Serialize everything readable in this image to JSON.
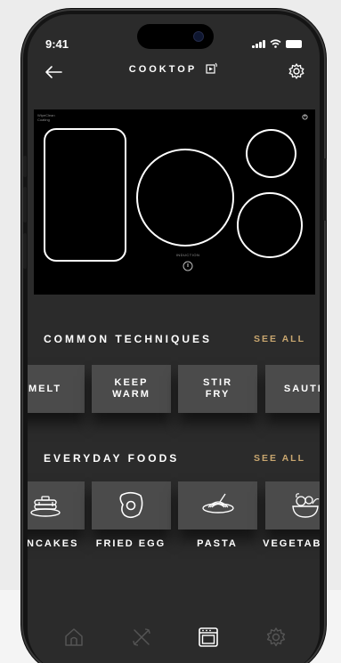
{
  "status_bar": {
    "time": "9:41"
  },
  "header": {
    "title": "COOKTOP"
  },
  "cooktop": {
    "brand": "WipeClean Coating",
    "induction_label": "INDUCTION"
  },
  "common_techniques": {
    "title": "COMMON TECHNIQUES",
    "see_all": "SEE ALL",
    "items": [
      {
        "label": "MELT"
      },
      {
        "label": "KEEP WARM"
      },
      {
        "label": "STIR FRY"
      },
      {
        "label": "SAUTE"
      }
    ]
  },
  "everyday_foods": {
    "title": "EVERYDAY FOODS",
    "see_all": "SEE ALL",
    "items": [
      {
        "label": "PANCAKES",
        "icon": "pancakes-icon"
      },
      {
        "label": "FRIED EGG",
        "icon": "fried-egg-icon"
      },
      {
        "label": "PASTA",
        "icon": "pasta-icon"
      },
      {
        "label": "VEGETABLES",
        "icon": "vegetables-icon"
      }
    ]
  },
  "tab_bar": {
    "items": [
      {
        "icon": "home-icon",
        "active": false
      },
      {
        "icon": "utensils-icon",
        "active": false
      },
      {
        "icon": "oven-icon",
        "active": true
      },
      {
        "icon": "settings-icon",
        "active": false
      }
    ]
  },
  "colors": {
    "accent": "#c8a66f",
    "background": "#2b2b2b",
    "tile": "#4b4b4b"
  }
}
